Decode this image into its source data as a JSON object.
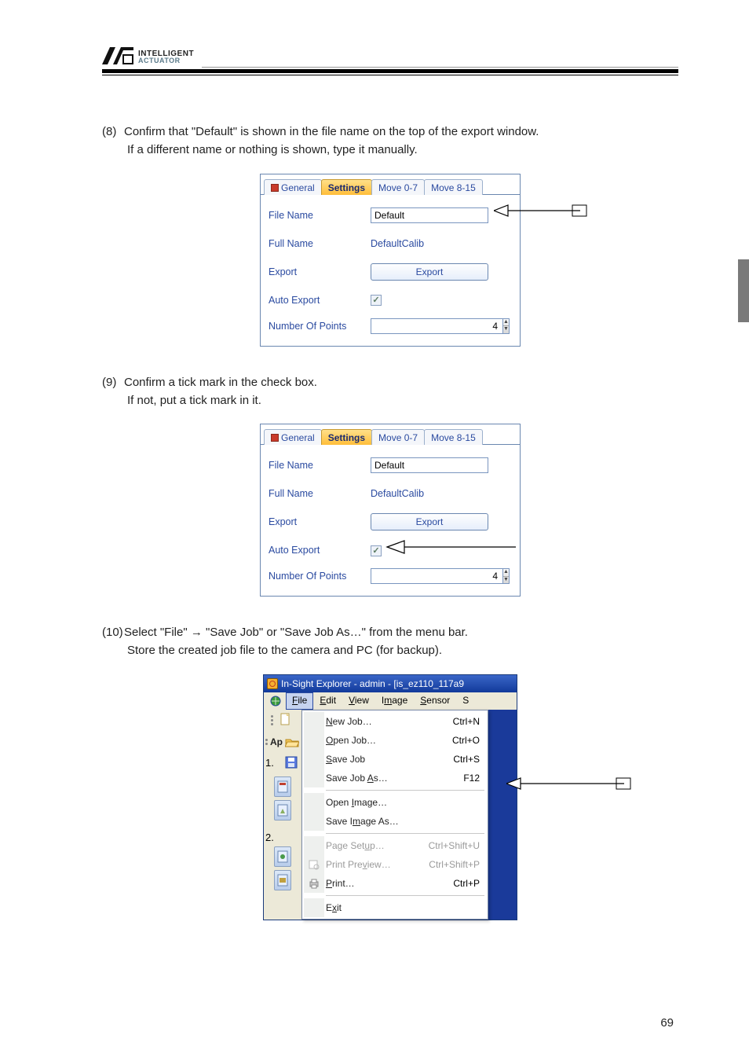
{
  "header": {
    "brand_line1": "INTELLIGENT",
    "brand_line2": "ACTUATOR"
  },
  "page_number": "69",
  "steps": {
    "s8": {
      "num": "(8)",
      "line1": "Confirm that \"Default\" is shown in the file name on the top of the export window.",
      "line2": "If a different name or nothing is shown, type it manually."
    },
    "s9": {
      "num": "(9)",
      "line1": "Confirm a tick mark in the check box.",
      "line2": "If not, put a tick mark in it."
    },
    "s10": {
      "num": "(10)",
      "line1": "Select \"File\" → \"Save Job\" or \"Save Job As…\" from the menu bar.",
      "line2": "Store the created job file to the camera and PC (for backup)."
    }
  },
  "settings_panel": {
    "tabs": {
      "general": "General",
      "settings": "Settings",
      "move07": "Move 0-7",
      "move815": "Move 8-15"
    },
    "rows": {
      "file_name_label": "File Name",
      "file_name_value": "Default",
      "full_name_label": "Full Name",
      "full_name_value": "DefaultCalib",
      "export_label": "Export",
      "export_button": "Export",
      "auto_export_label": "Auto Export",
      "number_points_label": "Number Of Points",
      "number_points_value": "4"
    }
  },
  "explorer": {
    "title": "In-Sight Explorer - admin - [is_ez110_117a9",
    "menubar": {
      "file": "File",
      "edit": "Edit",
      "view": "View",
      "image": "Image",
      "sensor": "Sensor",
      "s": "S"
    },
    "sidebar_label_ap": "Ap",
    "steps_col": {
      "s1": "1.",
      "s2": "2."
    },
    "file_menu": {
      "new_job": "New Job…",
      "new_job_k": "Ctrl+N",
      "open_job": "Open Job…",
      "open_job_k": "Ctrl+O",
      "save_job": "Save Job",
      "save_job_k": "Ctrl+S",
      "save_job_as": "Save Job As…",
      "save_job_as_k": "F12",
      "open_image": "Open Image…",
      "save_image_as": "Save Image As…",
      "page_setup": "Page Setup…",
      "page_setup_k": "Ctrl+Shift+U",
      "print_preview": "Print Preview…",
      "print_preview_k": "Ctrl+Shift+P",
      "print": "Print…",
      "print_k": "Ctrl+P",
      "exit": "Exit"
    }
  }
}
